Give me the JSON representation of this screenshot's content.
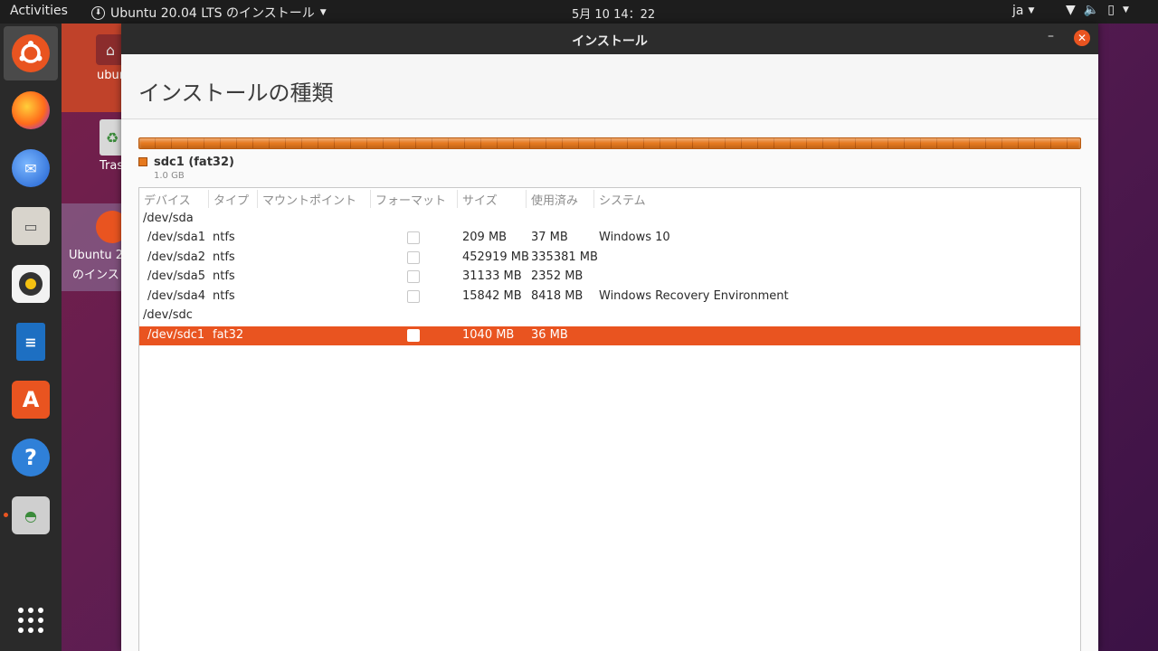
{
  "topbar": {
    "activities": "Activities",
    "app_menu": "Ubuntu 20.04 LTS のインストール",
    "clock": "5月 10  14：22",
    "lang": "ja"
  },
  "desktop": {
    "home_label": "ubun",
    "trash_label": "Tras",
    "install_label_1": "Ubuntu 2",
    "install_label_2": "のインス"
  },
  "window": {
    "title": "インストール",
    "heading": "インストールの種類"
  },
  "partition_bar": {
    "color": "#e6791e",
    "legend_name": "sdc1 (fat32)",
    "legend_size": "1.0 GB"
  },
  "table": {
    "headers": [
      "デバイス",
      "タイプ",
      "マウントポイント",
      "フォーマット",
      "サイズ",
      "使用済み",
      "システム"
    ],
    "rows": [
      {
        "device": "/dev/sda",
        "type": "",
        "size": "",
        "used": "",
        "system": "",
        "group": true
      },
      {
        "device": "/dev/sda1",
        "type": "ntfs",
        "size": "209 MB",
        "used": "37 MB",
        "system": "Windows 10"
      },
      {
        "device": "/dev/sda2",
        "type": "ntfs",
        "size": "452919 MB",
        "used": "335381 MB",
        "system": ""
      },
      {
        "device": "/dev/sda5",
        "type": "ntfs",
        "size": "31133 MB",
        "used": "2352 MB",
        "system": ""
      },
      {
        "device": "/dev/sda4",
        "type": "ntfs",
        "size": "15842 MB",
        "used": "8418 MB",
        "system": "Windows Recovery Environment"
      },
      {
        "device": "/dev/sdc",
        "type": "",
        "size": "",
        "used": "",
        "system": "",
        "group": true
      },
      {
        "device": "/dev/sdc1",
        "type": "fat32",
        "size": "1040 MB",
        "used": "36 MB",
        "system": "",
        "selected": true
      }
    ]
  },
  "colors": {
    "accent": "#e95420",
    "titlebar": "#2c2c2c",
    "dock": "#2a2a2a"
  }
}
